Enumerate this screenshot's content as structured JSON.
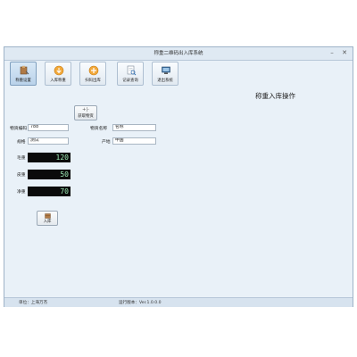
{
  "window": {
    "title": "称重二维码出入库系统",
    "minimize_glyph": "–",
    "close_glyph": "✕"
  },
  "toolbar": {
    "items": [
      {
        "label": "称重设置",
        "icon": "scale-settings-icon"
      },
      {
        "label": "入库称重",
        "icon": "inbound-weighing-icon"
      },
      {
        "label": "扫码出库",
        "icon": "scan-outbound-icon"
      },
      {
        "label": "记录查询",
        "icon": "record-query-icon"
      },
      {
        "label": "退出系统",
        "icon": "exit-system-icon"
      }
    ],
    "active_index": 0
  },
  "page": {
    "heading": "称重入库操作"
  },
  "form": {
    "fetch_button_glyph": "+|-",
    "fetch_button_label": "获取物资",
    "material_code_label": "物资编码",
    "material_code_value": "788",
    "material_name_label": "物资名称",
    "material_name_value": "名称",
    "spec_label": "规格",
    "spec_value": "测试",
    "origin_label": "产地",
    "origin_value": "中国",
    "gross_label": "毛重",
    "gross_value": "120",
    "tare_label": "皮重",
    "tare_value": "50",
    "net_label": "净重",
    "net_value": "70",
    "inbound_button_label": "入库"
  },
  "status": {
    "unit_text": "单位：上海万杰",
    "version_text": "运行版本：Ver.1.0.0.0"
  },
  "colors": {
    "led_text": "#9be9b4",
    "led_background": "#0b0b0b",
    "window_background": "#e9f1f8"
  }
}
